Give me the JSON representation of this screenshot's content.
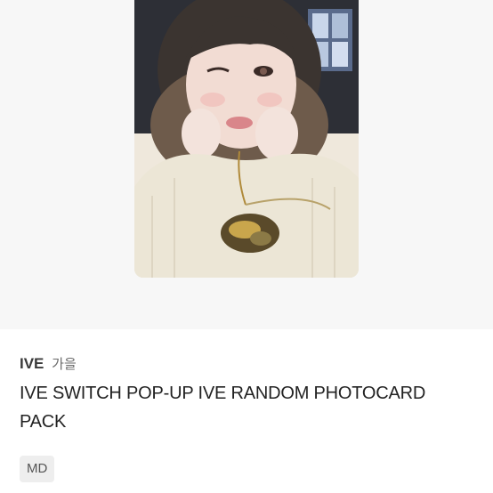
{
  "product": {
    "image_icon": "photocard-photo",
    "brand": "IVE",
    "member": "가을",
    "title": "IVE SWITCH POP-UP IVE RANDOM PHOTOCARD PACK",
    "category_badge": "MD"
  },
  "colors": {
    "hero_background": "#f7f7f7",
    "badge_background": "#eeeeee",
    "title_text": "#222222"
  }
}
